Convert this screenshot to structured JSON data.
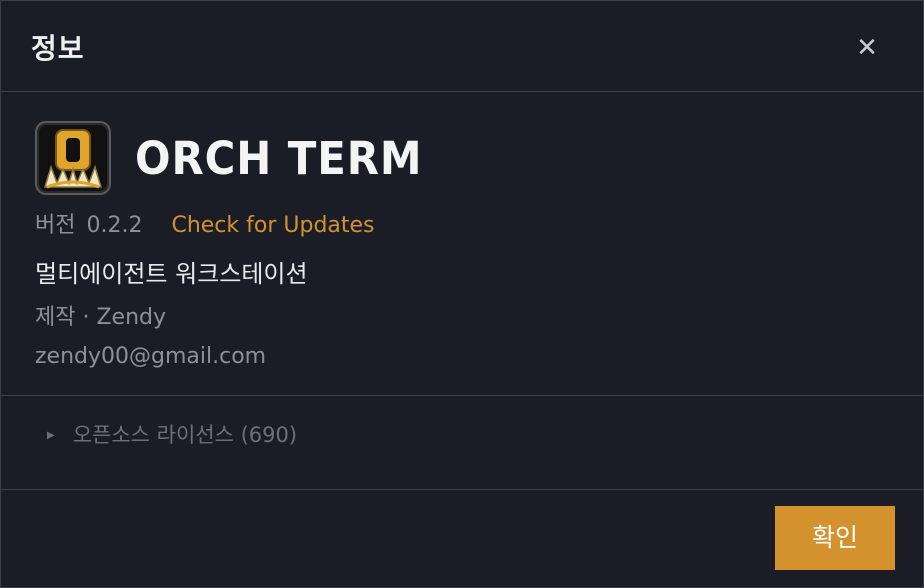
{
  "dialog": {
    "title": "정보",
    "close_icon": "close-icon"
  },
  "app": {
    "logo_icon": "orch-term-logo-icon",
    "name": "ORCH TERM",
    "version_label": "버전",
    "version": "0.2.2",
    "update_link": "Check for Updates",
    "description": "멀티에이전트 워크스테이션",
    "maker": "제작 · Zendy",
    "email": "zendy00@gmail.com"
  },
  "license": {
    "label": "오픈소스 라이선스 (690)",
    "expand_icon": "triangle-right-icon"
  },
  "footer": {
    "ok_label": "확인"
  },
  "colors": {
    "background": "#1a1d25",
    "border": "#3a3e48",
    "accent": "#d4922e",
    "muted_text": "#8d9099",
    "primary_text": "#f0f0f0"
  }
}
